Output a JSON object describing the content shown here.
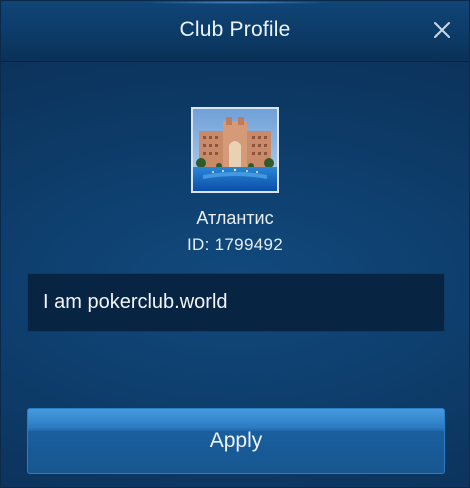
{
  "dialog": {
    "title": "Club Profile"
  },
  "icons": {
    "close": "close-icon"
  },
  "club": {
    "name": "Атлантис",
    "id_text": "ID: 1799492",
    "description": "I am pokerclub.world"
  },
  "actions": {
    "apply_label": "Apply"
  },
  "colors": {
    "background": "#0d3b68",
    "header": "#0c3a66",
    "input_background": "#082443",
    "button": "#1f6fb6",
    "text": "#eef4fb"
  }
}
